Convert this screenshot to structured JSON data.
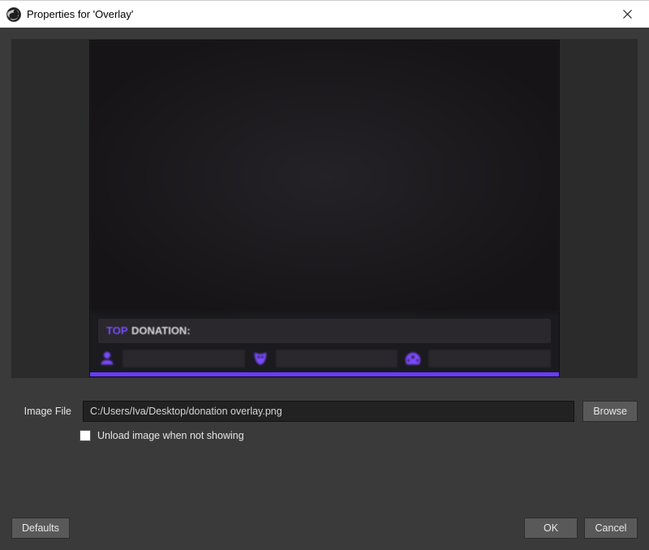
{
  "window": {
    "title": "Properties for 'Overlay'"
  },
  "preview": {
    "donation_top_label": "TOP",
    "donation_label": "DONATION:"
  },
  "form": {
    "image_file_label": "Image File",
    "image_file_value": "C:/Users/Iva/Desktop/donation overlay.png",
    "browse_label": "Browse",
    "unload_checkbox_label": "Unload image when not showing",
    "unload_checked": false
  },
  "footer": {
    "defaults_label": "Defaults",
    "ok_label": "OK",
    "cancel_label": "Cancel"
  }
}
